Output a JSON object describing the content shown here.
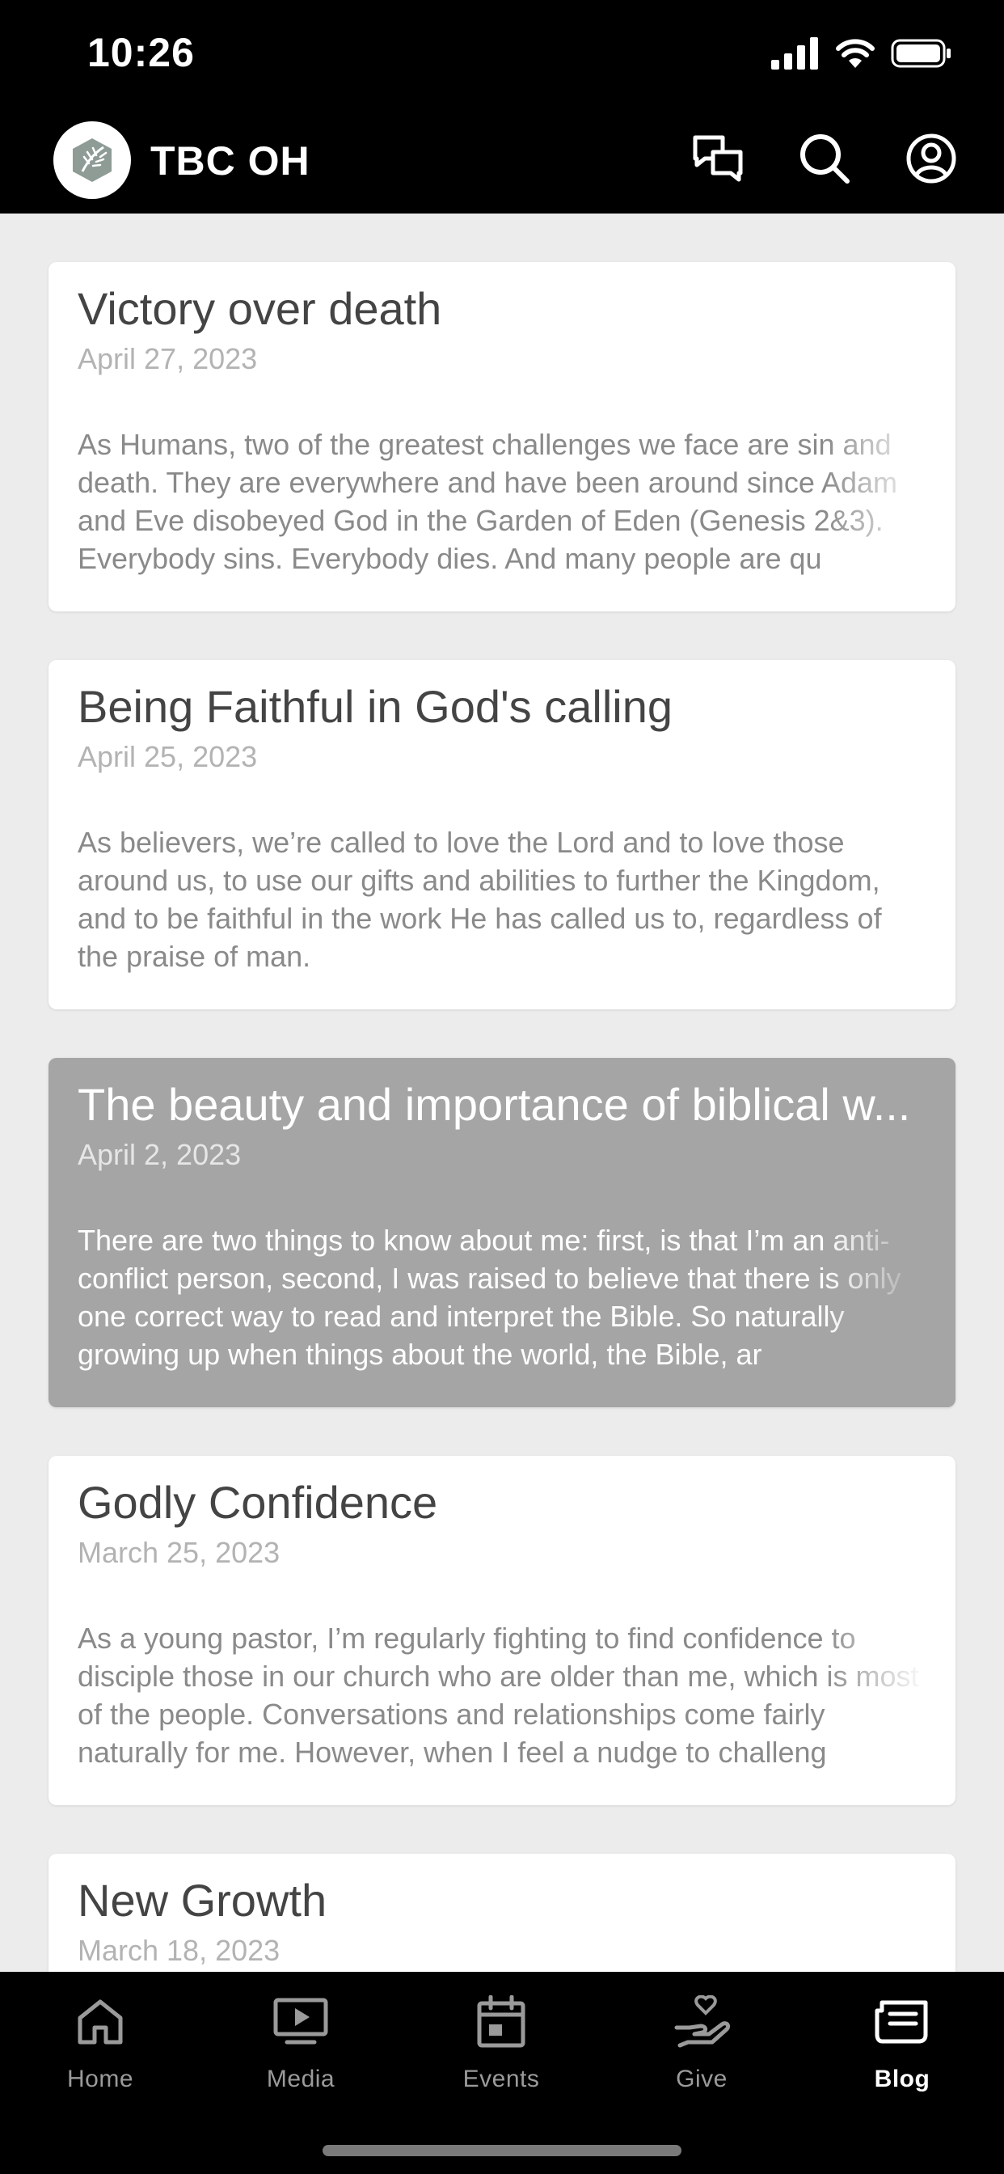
{
  "status_bar": {
    "time": "10:26"
  },
  "header": {
    "title": "TBC OH"
  },
  "posts": [
    {
      "title": "Victory over death",
      "date": "April 27, 2023",
      "excerpt": "As Humans, two of the greatest challenges we face are sin and death. They are everywhere and have been around since Adam and Eve disobeyed God in the Garden of Eden (Genesis 2&3). Everybody sins. Everybody dies. And many people are qu"
    },
    {
      "title": "Being Faithful in God's calling",
      "date": "April 25, 2023",
      "excerpt": "As believers, we’re called to love the Lord and to love those around us, to use our gifts and abilities to further the Kingdom, and to be faithful in the work He has called us to, regardless of the praise of man."
    },
    {
      "title": "The beauty and importance of biblical w...",
      "date": "April 2, 2023",
      "excerpt": "There are two things to know about me: first, is that I’m an anti-conflict person, second, I was raised to believe that there is only one correct way to read and interpret the Bible. So naturally growing up when things about the world, the Bible, ar"
    },
    {
      "title": "Godly Confidence",
      "date": "March 25, 2023",
      "excerpt": "As a young pastor, I’m regularly fighting to find confidence to disciple those in our church who are older than me, which is most of the people. Conversations and relationships come fairly naturally for me. However, when I feel a nudge to challeng"
    },
    {
      "title": "New Growth",
      "date": "March 18, 2023",
      "excerpt": ""
    }
  ],
  "tabs": [
    {
      "label": "Home",
      "icon": "home-icon"
    },
    {
      "label": "Media",
      "icon": "media-icon"
    },
    {
      "label": "Events",
      "icon": "calendar-icon"
    },
    {
      "label": "Give",
      "icon": "give-icon"
    },
    {
      "label": "Blog",
      "icon": "blog-icon"
    }
  ],
  "colors": {
    "active_card": "#a5a5a5",
    "background": "#ececec",
    "bar": "#000000"
  }
}
